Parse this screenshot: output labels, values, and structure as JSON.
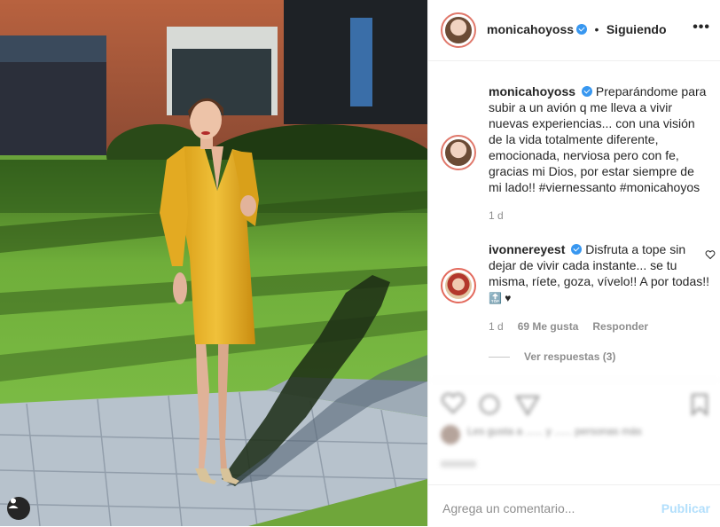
{
  "post": {
    "author": "monicahoyoss",
    "follow_status": "Siguiendo",
    "separator": "•",
    "more": "•••"
  },
  "caption": {
    "author": "monicahoyoss",
    "text": "Preparándome para subir a un avión q me lleva a vivir nuevas experiencias... con una visión de la vida totalmente diferente, emocionada, nerviosa pero con fe, gracias mi Dios, por estar siempre de mi lado!! #viernessanto #monicahoyos",
    "age": "1 d"
  },
  "comments": [
    {
      "author": "ivonnereyest",
      "text": "Disfruta a tope sin dejar de vivir cada instante... se tu misma, ríete, goza, vívelo!! A por todas!!",
      "emoji": "🔝 ♥",
      "age": "1 d",
      "likes": "69 Me gusta",
      "reply": "Responder",
      "view_replies": "Ver respuestas (3)"
    }
  ],
  "blurred_likes": "Les gusta a ...... y ...... personas más",
  "composer": {
    "placeholder": "Agrega un comentario...",
    "publish": "Publicar"
  },
  "colors": {
    "verified": "#3897f0",
    "publish_disabled": "#b2dffc",
    "muted": "#8e8e8e",
    "dress": "#e6b423"
  }
}
